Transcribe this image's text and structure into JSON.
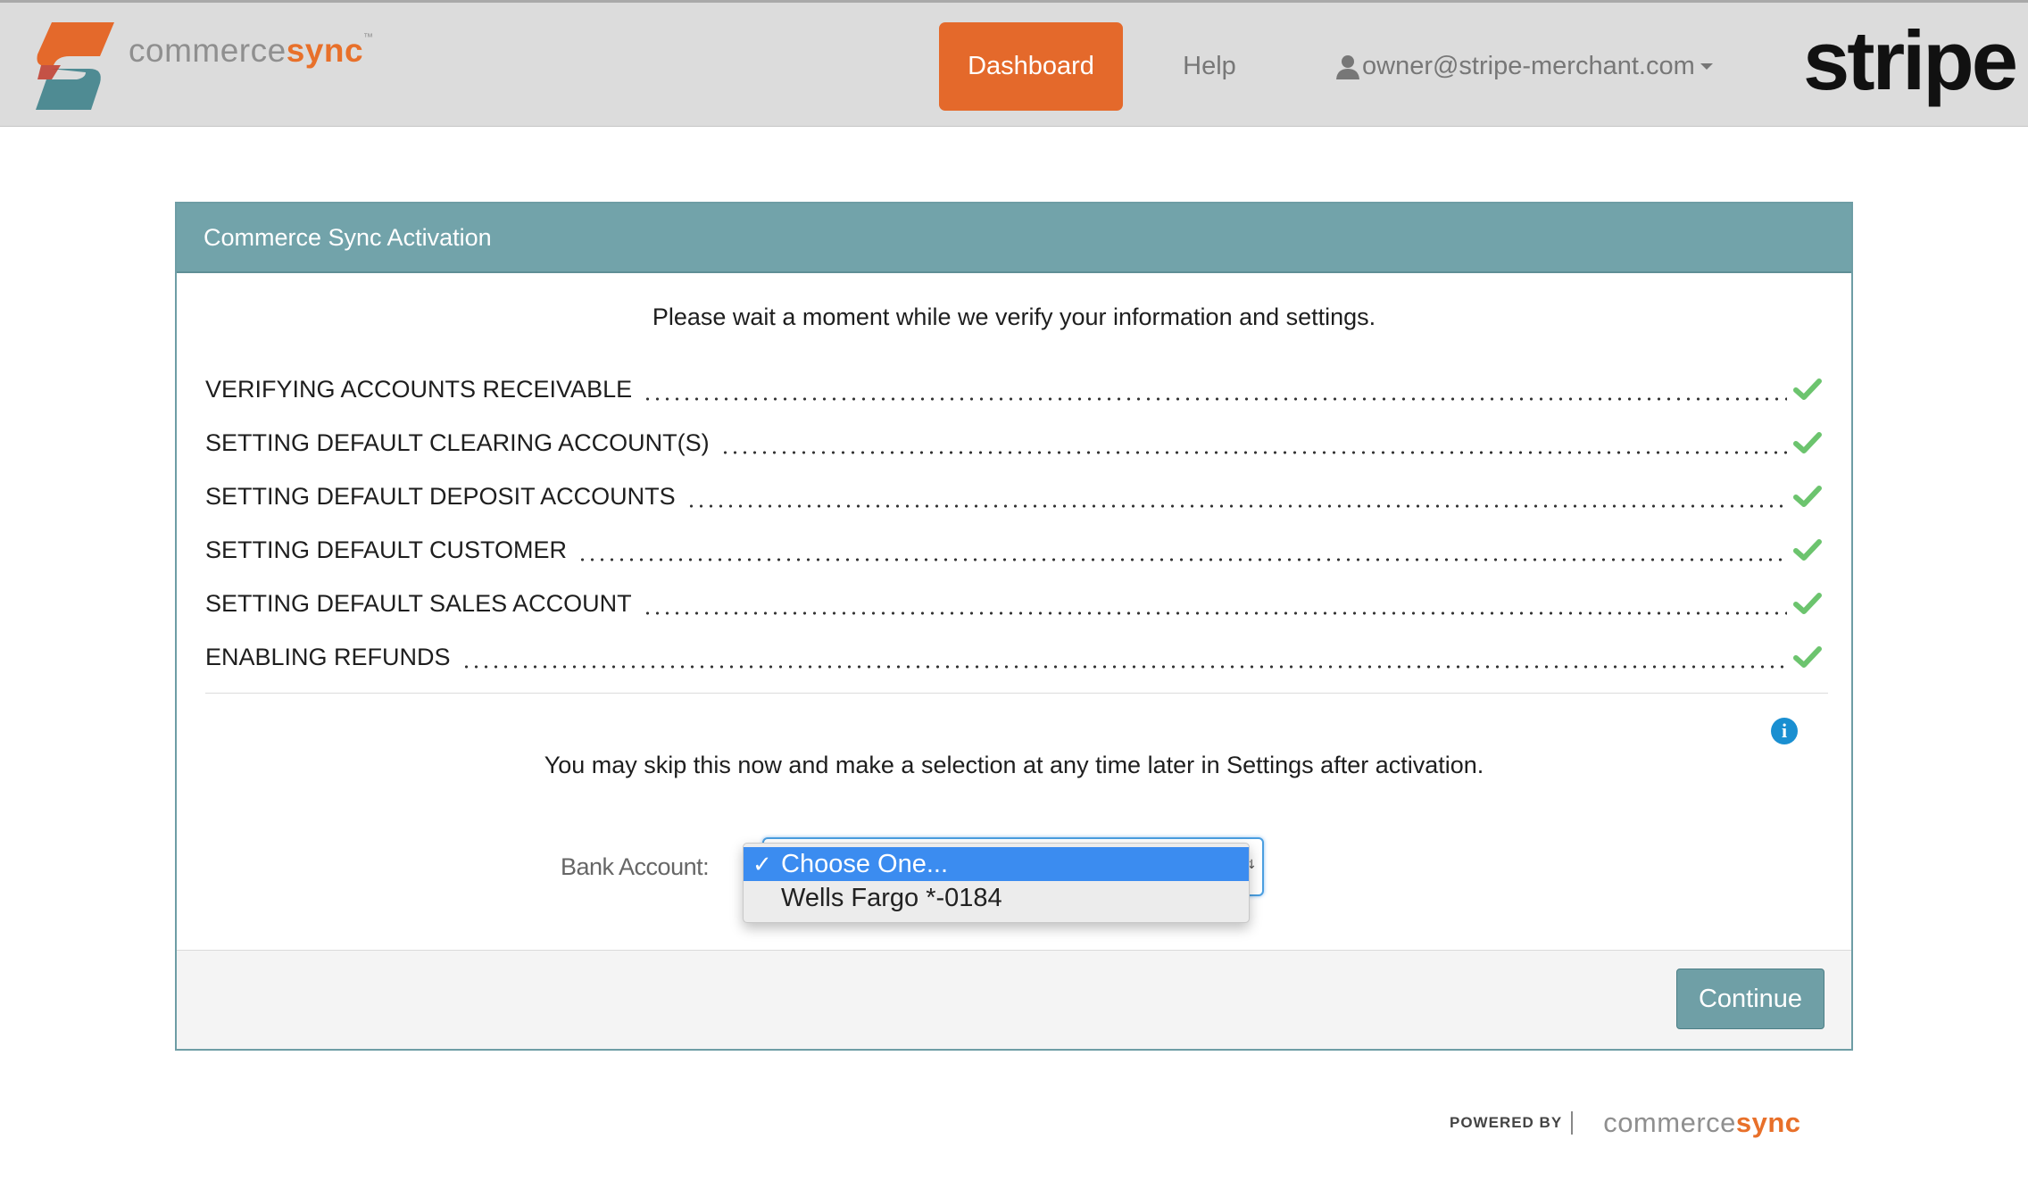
{
  "brand": {
    "name_part1": "commerce",
    "name_part2": "sync",
    "trademark": "™"
  },
  "nav": {
    "dashboard": "Dashboard",
    "help": "Help",
    "user_email": "owner@stripe-merchant.com"
  },
  "partner_logo": "stripe",
  "panel": {
    "title": "Commerce Sync Activation",
    "intro": "Please wait a moment while we verify your information and settings.",
    "steps": [
      {
        "label": "VERIFYING ACCOUNTS RECEIVABLE",
        "status": "complete"
      },
      {
        "label": "SETTING DEFAULT CLEARING ACCOUNT(S)",
        "status": "complete"
      },
      {
        "label": "SETTING DEFAULT DEPOSIT ACCOUNTS",
        "status": "complete"
      },
      {
        "label": "SETTING DEFAULT CUSTOMER",
        "status": "complete"
      },
      {
        "label": "SETTING DEFAULT SALES ACCOUNT",
        "status": "complete"
      },
      {
        "label": "ENABLING REFUNDS",
        "status": "complete"
      }
    ],
    "skip_note": "You may skip this now and make a selection at any time later in Settings after activation.",
    "bank_account": {
      "label": "Bank Account:",
      "selected": "Choose One...",
      "options": [
        "Choose One...",
        "Wells Fargo *-0184"
      ]
    },
    "continue_label": "Continue"
  },
  "footer": {
    "powered_by": "POWERED BY",
    "name_part1": "commerce",
    "name_part2": "sync"
  },
  "colors": {
    "accent_orange": "#e4692b",
    "panel_teal": "#72a3aa",
    "check_green": "#6cc46e",
    "select_blue": "#3b8cf0",
    "info_blue": "#1a8fd1"
  }
}
